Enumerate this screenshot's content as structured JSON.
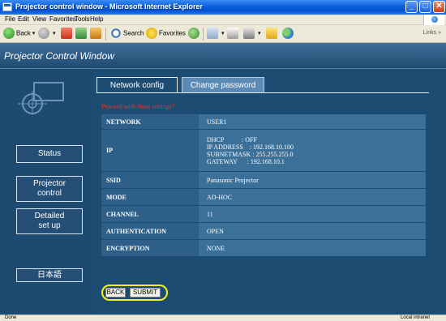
{
  "window": {
    "title": "Projector control window - Microsoft Internet Explorer",
    "minimize": "_",
    "maximize": "□",
    "close": "✕"
  },
  "menu": [
    "File",
    "Edit",
    "View",
    "Favorites",
    "Tools",
    "Help"
  ],
  "toolbar": {
    "back_label": "Back",
    "search_label": "Search",
    "favorites_label": "Favorites",
    "links_label": "Links",
    "links_chevron": "»"
  },
  "app": {
    "title": "Projector Control Window"
  },
  "sidebar": {
    "status": "Status",
    "projector_control_1": "Projector",
    "projector_control_2": "control",
    "detailed_1": "Detailed",
    "detailed_2": "set up",
    "japanese": "日本語"
  },
  "tabs": {
    "network_config": "Network config",
    "change_password": "Change password"
  },
  "warning": "Proceed with these settings?",
  "settings": {
    "network": {
      "key": "NETWORK",
      "value": "USER1"
    },
    "ip": {
      "key": "IP",
      "dhcp": "DHCP           : OFF",
      "ip_address": "IP ADDRESS    : 192.168.10.100",
      "subnet": "SUBNETMASK : 255.255.255.0",
      "gateway": "GATEWAY      : 192.168.10.1"
    },
    "ssid": {
      "key": "SSID",
      "value": "Panasonic Projector"
    },
    "mode": {
      "key": "MODE",
      "value": "AD-HOC"
    },
    "channel": {
      "key": "CHANNEL",
      "value": "11"
    },
    "authentication": {
      "key": "AUTHENTICATION",
      "value": "OPEN"
    },
    "encryption": {
      "key": "ENCRYPTION",
      "value": "NONE"
    }
  },
  "buttons": {
    "back": "BACK",
    "submit": "SUBMIT"
  },
  "statusbar": {
    "done": "Done",
    "zone": "Local intranet"
  },
  "colors": {
    "page_bg": "#1d4c73",
    "key_bg": "#2d5f88",
    "value_bg": "#3b7099",
    "warning": "#e0392b",
    "highlight": "#f3f316"
  }
}
